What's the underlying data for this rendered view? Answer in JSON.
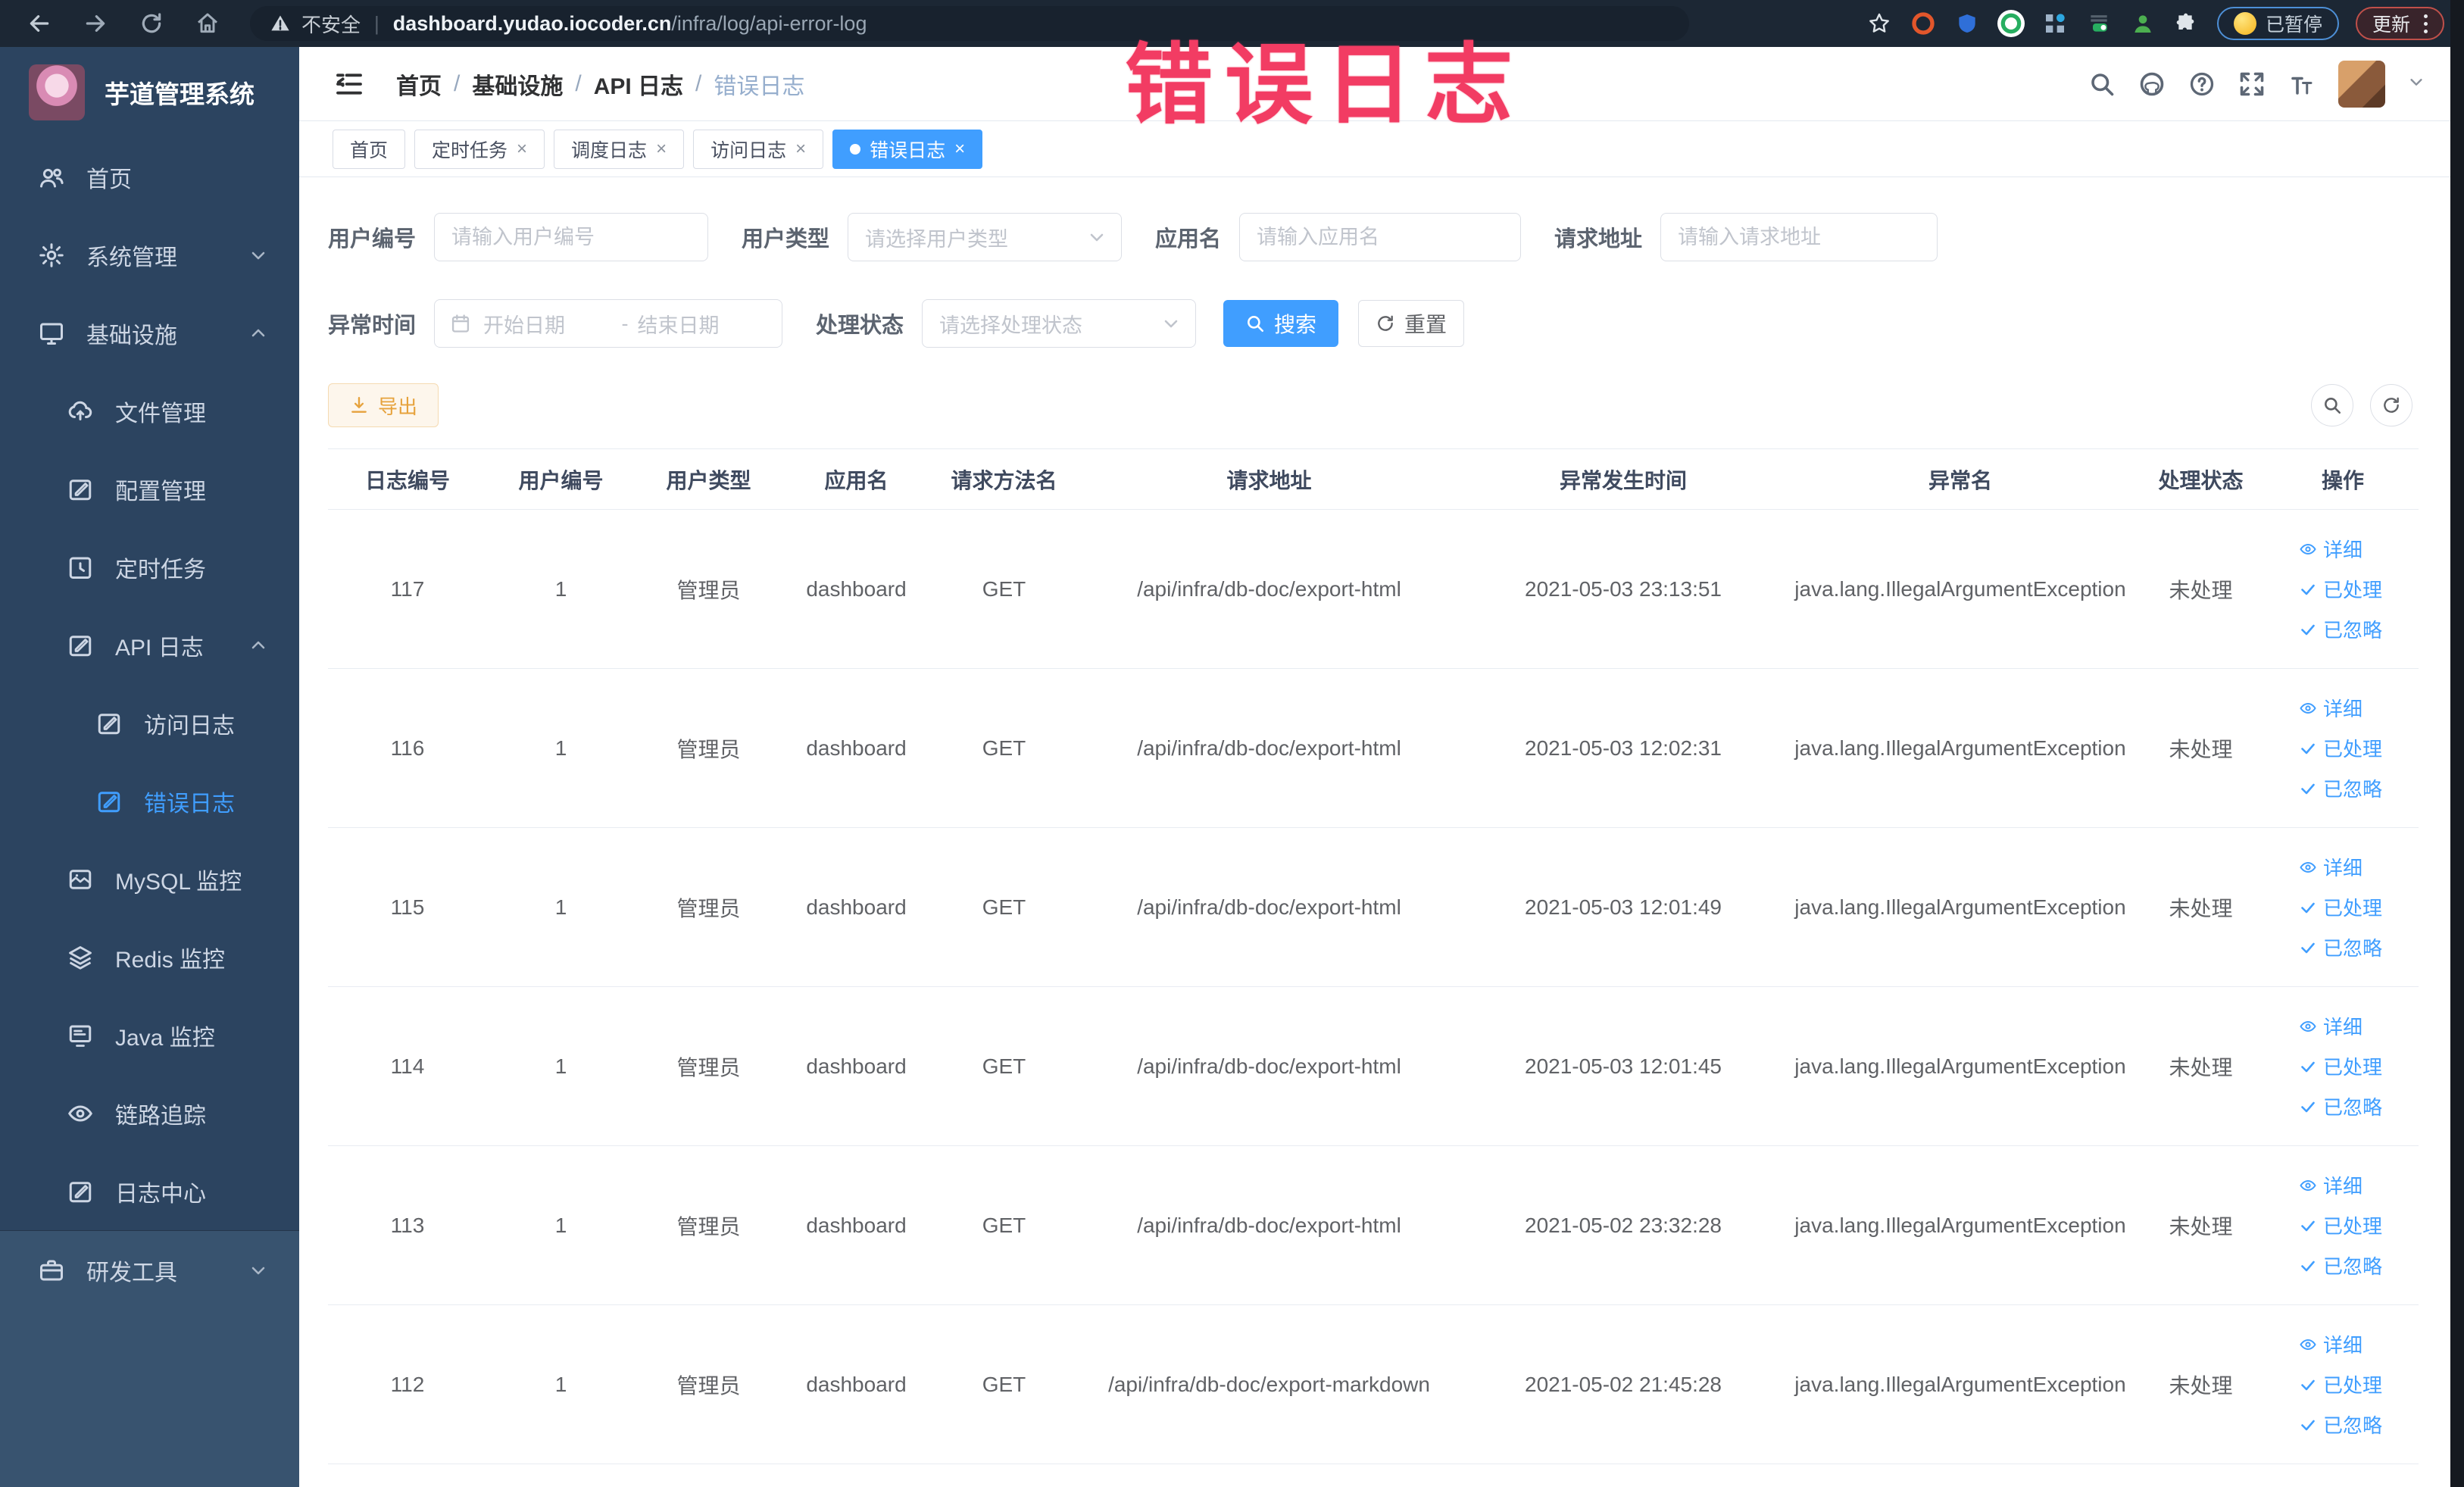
{
  "browser": {
    "security_label": "不安全",
    "url_domain": "dashboard.yudao.iocoder.cn",
    "url_path": "/infra/log/api-error-log",
    "paused_badge": "已暂停",
    "update_badge": "更新",
    "extension_icons": [
      "bookmark-star",
      "adblock",
      "shield",
      "green-check",
      "extensions-grid",
      "switch-on",
      "user-green",
      "puzzle"
    ]
  },
  "overlay_title": "错误日志",
  "sidebar": {
    "title": "芋道管理系统",
    "items": [
      {
        "label": "首页"
      },
      {
        "label": "系统管理"
      },
      {
        "label": "基础设施"
      },
      {
        "label": "文件管理"
      },
      {
        "label": "配置管理"
      },
      {
        "label": "定时任务"
      },
      {
        "label": "API 日志"
      },
      {
        "label": "访问日志"
      },
      {
        "label": "错误日志"
      },
      {
        "label": "MySQL 监控"
      },
      {
        "label": "Redis 监控"
      },
      {
        "label": "Java 监控"
      },
      {
        "label": "链路追踪"
      },
      {
        "label": "日志中心"
      },
      {
        "label": "研发工具"
      }
    ]
  },
  "breadcrumb": {
    "items": [
      "首页",
      "基础设施",
      "API 日志",
      "错误日志"
    ],
    "separator": "/"
  },
  "tabs": [
    {
      "label": "首页"
    },
    {
      "label": "定时任务"
    },
    {
      "label": "调度日志"
    },
    {
      "label": "访问日志"
    },
    {
      "label": "错误日志"
    }
  ],
  "filters": {
    "user_id": {
      "label": "用户编号",
      "placeholder": "请输入用户编号"
    },
    "user_type": {
      "label": "用户类型",
      "placeholder": "请选择用户类型"
    },
    "app_name": {
      "label": "应用名",
      "placeholder": "请输入应用名"
    },
    "request_url": {
      "label": "请求地址",
      "placeholder": "请输入请求地址"
    },
    "exception_time": {
      "label": "异常时间",
      "start_placeholder": "开始日期",
      "separator": "-",
      "end_placeholder": "结束日期"
    },
    "process_status": {
      "label": "处理状态",
      "placeholder": "请选择处理状态"
    },
    "search_button": "搜索",
    "reset_button": "重置"
  },
  "toolbar": {
    "export_button": "导出"
  },
  "table": {
    "columns": [
      "日志编号",
      "用户编号",
      "用户类型",
      "应用名",
      "请求方法名",
      "请求地址",
      "异常发生时间",
      "异常名",
      "处理状态",
      "操作"
    ],
    "actions": {
      "detail": "详细",
      "processed": "已处理",
      "ignored": "已忽略"
    },
    "rows": [
      {
        "id": "117",
        "user_id": "1",
        "user_type": "管理员",
        "app": "dashboard",
        "method": "GET",
        "url": "/api/infra/db-doc/export-html",
        "time": "2021-05-03 23:13:51",
        "exception": "java.lang.IllegalArgumentException",
        "status": "未处理"
      },
      {
        "id": "116",
        "user_id": "1",
        "user_type": "管理员",
        "app": "dashboard",
        "method": "GET",
        "url": "/api/infra/db-doc/export-html",
        "time": "2021-05-03 12:02:31",
        "exception": "java.lang.IllegalArgumentException",
        "status": "未处理"
      },
      {
        "id": "115",
        "user_id": "1",
        "user_type": "管理员",
        "app": "dashboard",
        "method": "GET",
        "url": "/api/infra/db-doc/export-html",
        "time": "2021-05-03 12:01:49",
        "exception": "java.lang.IllegalArgumentException",
        "status": "未处理"
      },
      {
        "id": "114",
        "user_id": "1",
        "user_type": "管理员",
        "app": "dashboard",
        "method": "GET",
        "url": "/api/infra/db-doc/export-html",
        "time": "2021-05-03 12:01:45",
        "exception": "java.lang.IllegalArgumentException",
        "status": "未处理"
      },
      {
        "id": "113",
        "user_id": "1",
        "user_type": "管理员",
        "app": "dashboard",
        "method": "GET",
        "url": "/api/infra/db-doc/export-html",
        "time": "2021-05-02 23:32:28",
        "exception": "java.lang.IllegalArgumentException",
        "status": "未处理"
      },
      {
        "id": "112",
        "user_id": "1",
        "user_type": "管理员",
        "app": "dashboard",
        "method": "GET",
        "url": "/api/infra/db-doc/export-markdown",
        "time": "2021-05-02 21:45:28",
        "exception": "java.lang.IllegalArgumentException",
        "status": "未处理"
      }
    ]
  },
  "colors": {
    "primary": "#409eff",
    "warning": "#e6a23c",
    "overlay_title": "#f23c63",
    "sidebar_bg": "#2c4460",
    "browser_bar_bg": "#1c2734"
  }
}
